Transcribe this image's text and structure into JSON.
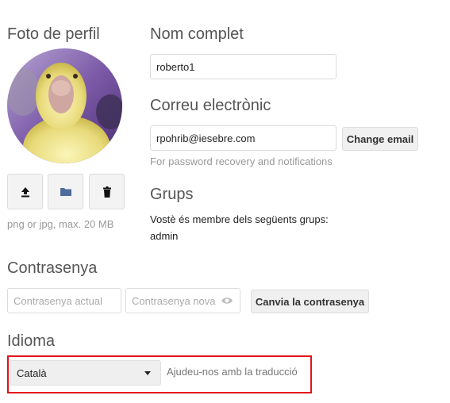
{
  "profile_picture": {
    "title": "Foto de perfil",
    "upload_icon": "upload-icon",
    "choose_icon": "folder-icon",
    "delete_icon": "trash-icon",
    "hint": "png or jpg, max. 20 MB"
  },
  "full_name": {
    "title": "Nom complet",
    "value": "roberto1"
  },
  "email": {
    "title": "Correu electrònic",
    "value": "rpohrib@iesebre.com",
    "change_button": "Change email",
    "hint": "For password recovery and notifications"
  },
  "groups": {
    "title": "Grups",
    "description": "Vostè és membre dels següents grups:",
    "list": "admin"
  },
  "password": {
    "title": "Contrasenya",
    "current_placeholder": "Contrasenya actual",
    "new_placeholder": "Contrasenya nova",
    "show_icon": "eye-icon",
    "change_button": "Canvia la contrasenya"
  },
  "language": {
    "title": "Idioma",
    "selected": "Català",
    "help_link": "Ajudeu-nos amb la traducció"
  },
  "colors": {
    "highlight": "#e2111b",
    "button_bg": "#f0f0f0",
    "section_title": "#555555"
  }
}
